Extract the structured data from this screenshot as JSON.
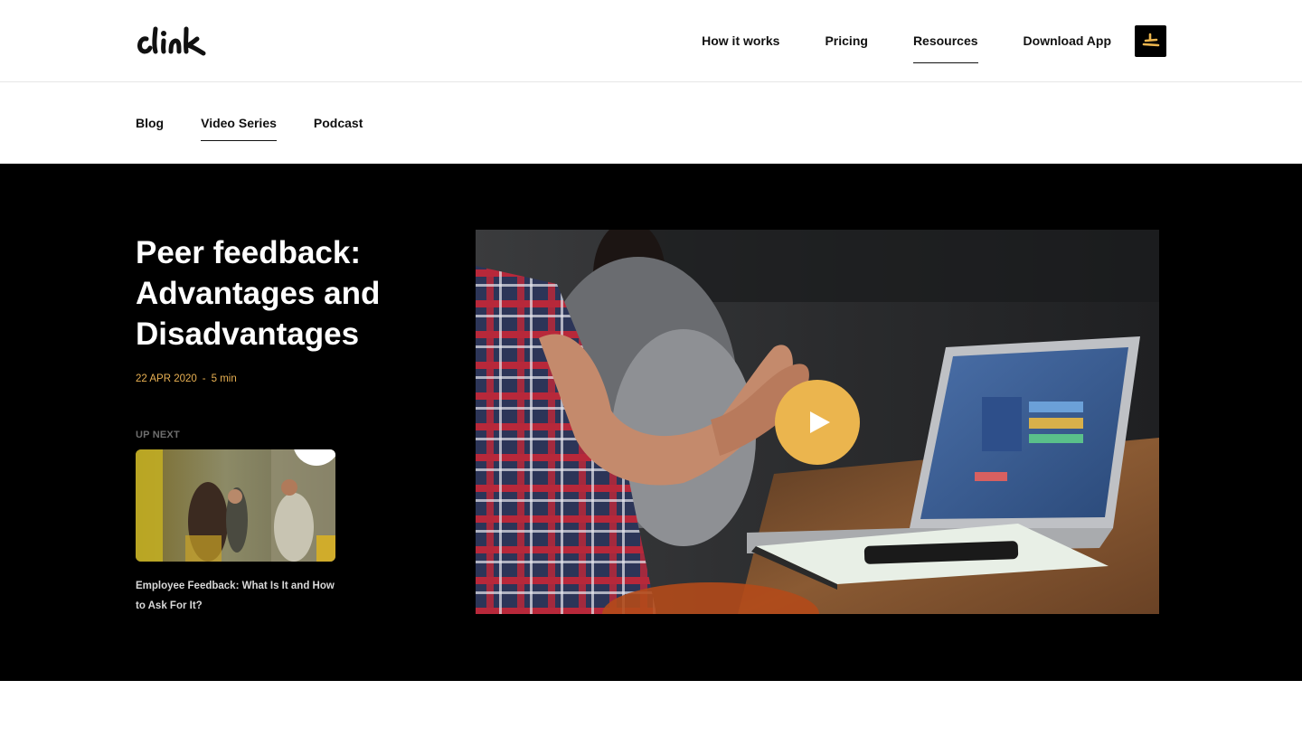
{
  "brand": {
    "logo_text": "clink"
  },
  "header": {
    "nav": [
      {
        "label": "How it works",
        "active": false
      },
      {
        "label": "Pricing",
        "active": false
      },
      {
        "label": "Resources",
        "active": true
      },
      {
        "label": "Download App",
        "active": false
      }
    ],
    "app_icon": "app-menu-icon"
  },
  "subnav": {
    "items": [
      {
        "label": "Blog",
        "active": false
      },
      {
        "label": "Video Series",
        "active": true
      },
      {
        "label": "Podcast",
        "active": false
      }
    ]
  },
  "hero": {
    "title": "Peer feedback: Advantages and Disadvantages",
    "date": "22 APR 2020",
    "separator": "-",
    "duration": "5 min",
    "up_next": {
      "label": "UP NEXT",
      "title": "Employee Feedback: What Is It and How to Ask For It?"
    },
    "video": {
      "play_icon": "play-icon"
    }
  },
  "colors": {
    "accent": "#ebb54e",
    "meta_text": "#e8b052",
    "hero_bg": "#000000"
  }
}
